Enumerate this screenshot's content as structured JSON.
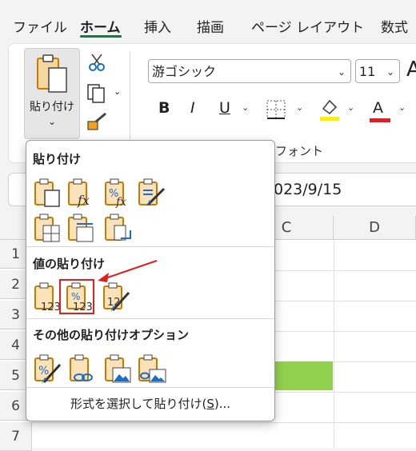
{
  "tabs": [
    "ファイル",
    "ホーム",
    "挿入",
    "描画",
    "ページ レイアウト",
    "数式"
  ],
  "ribbon": {
    "paste_label": "貼り付け",
    "paste_chevron": "⌄",
    "font_name": "游ゴシック",
    "font_size": "11",
    "bold": "B",
    "italic": "I",
    "underline": "U",
    "font_color_letter": "A",
    "font_group_label": "フォント",
    "accent_colors": {
      "highlight": "#ffef00",
      "font_color": "#e02020"
    }
  },
  "formula_bar": {
    "value": "023/9/15"
  },
  "grid": {
    "columns": [
      "C",
      "D"
    ],
    "rows": [
      "1",
      "2",
      "3",
      "4",
      "5",
      "6",
      "7"
    ],
    "highlight_fill": "#92d050"
  },
  "paste_menu": {
    "section1": "貼り付け",
    "section2": "値の貼り付け",
    "section3": "その他の貼り付けオプション",
    "paste_special": "形式を選択して貼り付け(",
    "paste_special_key": "S",
    "paste_special_tail": ")...",
    "icon_labels": {
      "formula": "fx",
      "percent": "%",
      "values": "123",
      "values_partial": "12"
    }
  }
}
